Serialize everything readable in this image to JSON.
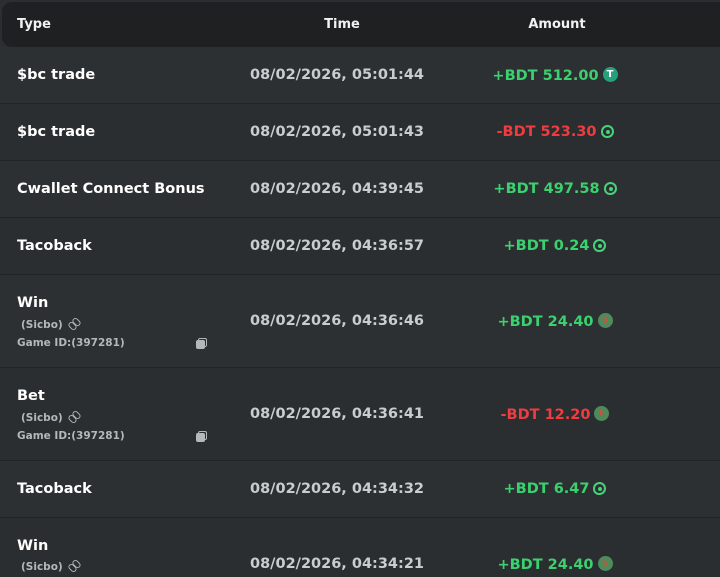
{
  "header": {
    "type": "Type",
    "time": "Time",
    "amount": "Amount"
  },
  "rows": [
    {
      "type": "$bc trade",
      "time": "08/02/2026, 05:01:44",
      "amount": "+BDT 512.00",
      "coin_icon": "usdt-coin-icon"
    },
    {
      "type": "$bc trade",
      "time": "08/02/2026, 05:01:43",
      "amount": "-BDT 523.30",
      "coin_icon": "bcd-coin-icon"
    },
    {
      "type": "Cwallet Connect Bonus",
      "time": "08/02/2026, 04:39:45",
      "amount": "+BDT 497.58",
      "coin_icon": "bcd-coin-icon"
    },
    {
      "type": "Tacoback",
      "time": "08/02/2026, 04:36:57",
      "amount": "+BDT 0.24",
      "coin_icon": "bcd-coin-icon"
    },
    {
      "type": "Win",
      "sub": "(Sicbo)",
      "game_id": "Game ID:(397281)",
      "time": "08/02/2026, 04:36:46",
      "amount": "+BDT 24.40",
      "coin_icon": "bdt-coin-icon"
    },
    {
      "type": "Bet",
      "sub": "(Sicbo)",
      "game_id": "Game ID:(397281)",
      "time": "08/02/2026, 04:36:41",
      "amount": "-BDT 12.20",
      "coin_icon": "bdt-coin-icon"
    },
    {
      "type": "Tacoback",
      "time": "08/02/2026, 04:34:32",
      "amount": "+BDT 6.47",
      "coin_icon": "bcd-coin-icon"
    },
    {
      "type": "Win",
      "sub": "(Sicbo)",
      "time": "08/02/2026, 04:34:21",
      "amount": "+BDT 24.40",
      "coin_icon": "bdt-coin-icon"
    }
  ],
  "colors": {
    "positive": "#3bd16f",
    "negative": "#ef3c40",
    "background": "#2b2e30",
    "header_bg": "#1e2022"
  }
}
